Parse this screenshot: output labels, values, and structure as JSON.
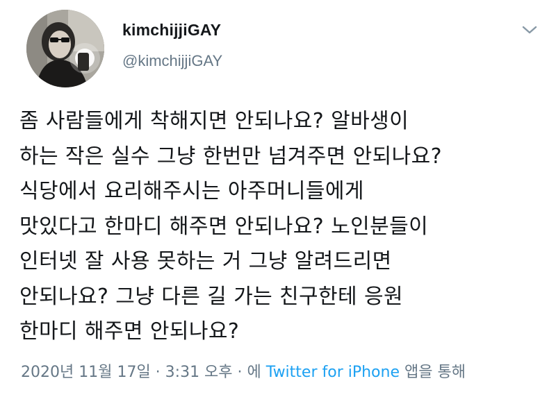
{
  "user": {
    "display_name": "kimchijjiGAY",
    "handle": "@kimchijjiGAY"
  },
  "icons": {
    "avatar": "profile-photo",
    "menu": "chevron-down-icon"
  },
  "tweet": {
    "lines": [
      "좀 사람들에게 착해지면 안되나요? 알바생이",
      "하는 작은 실수 그냥 한번만 넘겨주면 안되나요?",
      "식당에서 요리해주시는 아주머니들에게",
      "맛있다고 한마디 해주면 안되나요? 노인분들이",
      "인터넷 잘 사용 못하는 거 그냥 알려드리면",
      "안되나요? 그냥 다른 길 가는 친구한테 응원",
      "한마디 해주면 안되나요?"
    ]
  },
  "meta": {
    "timestamp": "2020년 11월 17일 · 3:31 오후 · 에",
    "source": "Twitter for iPhone",
    "suffix": "앱을 통해"
  },
  "colors": {
    "text": "#14171a",
    "secondary": "#657786",
    "link": "#1da1f2"
  }
}
